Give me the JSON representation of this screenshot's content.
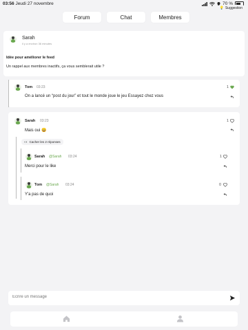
{
  "status_bar": {
    "time": "03:56",
    "date": "Jeudi 27 novembre",
    "battery": "70 %",
    "icons": [
      "signal-icon",
      "wifi-icon",
      "location-icon",
      "battery-icon"
    ]
  },
  "tabs": [
    {
      "label": "Forum"
    },
    {
      "label": "Chat"
    },
    {
      "label": "Membres"
    }
  ],
  "post": {
    "author": "Sarah",
    "time_ago": "il y a environ 36 minutes",
    "tag": "Suggestion",
    "title": "Idée pour améliorer le feed",
    "body": "Un rappel aux membres inactifs, ça vous semblerait utile ?"
  },
  "comments": [
    {
      "author": "Tom",
      "time": "03:23",
      "text": "On a lancé un “post du jour” et tout le monde joue le jeu Essayez chez vous",
      "likes": "1",
      "liked": true
    },
    {
      "author": "Sarah",
      "time": "03:23",
      "text": "Mais oui 😄",
      "likes": "1",
      "liked": false,
      "toggle_label": "Cacher les 2 réponses",
      "replies": [
        {
          "author": "Sarah",
          "mention": "@Sarah",
          "time": "03:24",
          "text": "Merci pour le like",
          "likes": "1"
        },
        {
          "author": "Tom",
          "mention": "@Sarah",
          "time": "03:24",
          "text": "Y'a pas de quoi",
          "likes": "0"
        }
      ]
    }
  ],
  "composer": {
    "placeholder": "Écrire un message"
  },
  "colors": {
    "accent": "#6aa84f",
    "background": "#f3f3f5",
    "card": "#ffffff"
  },
  "nav": [
    "home-icon",
    "profile-icon"
  ]
}
